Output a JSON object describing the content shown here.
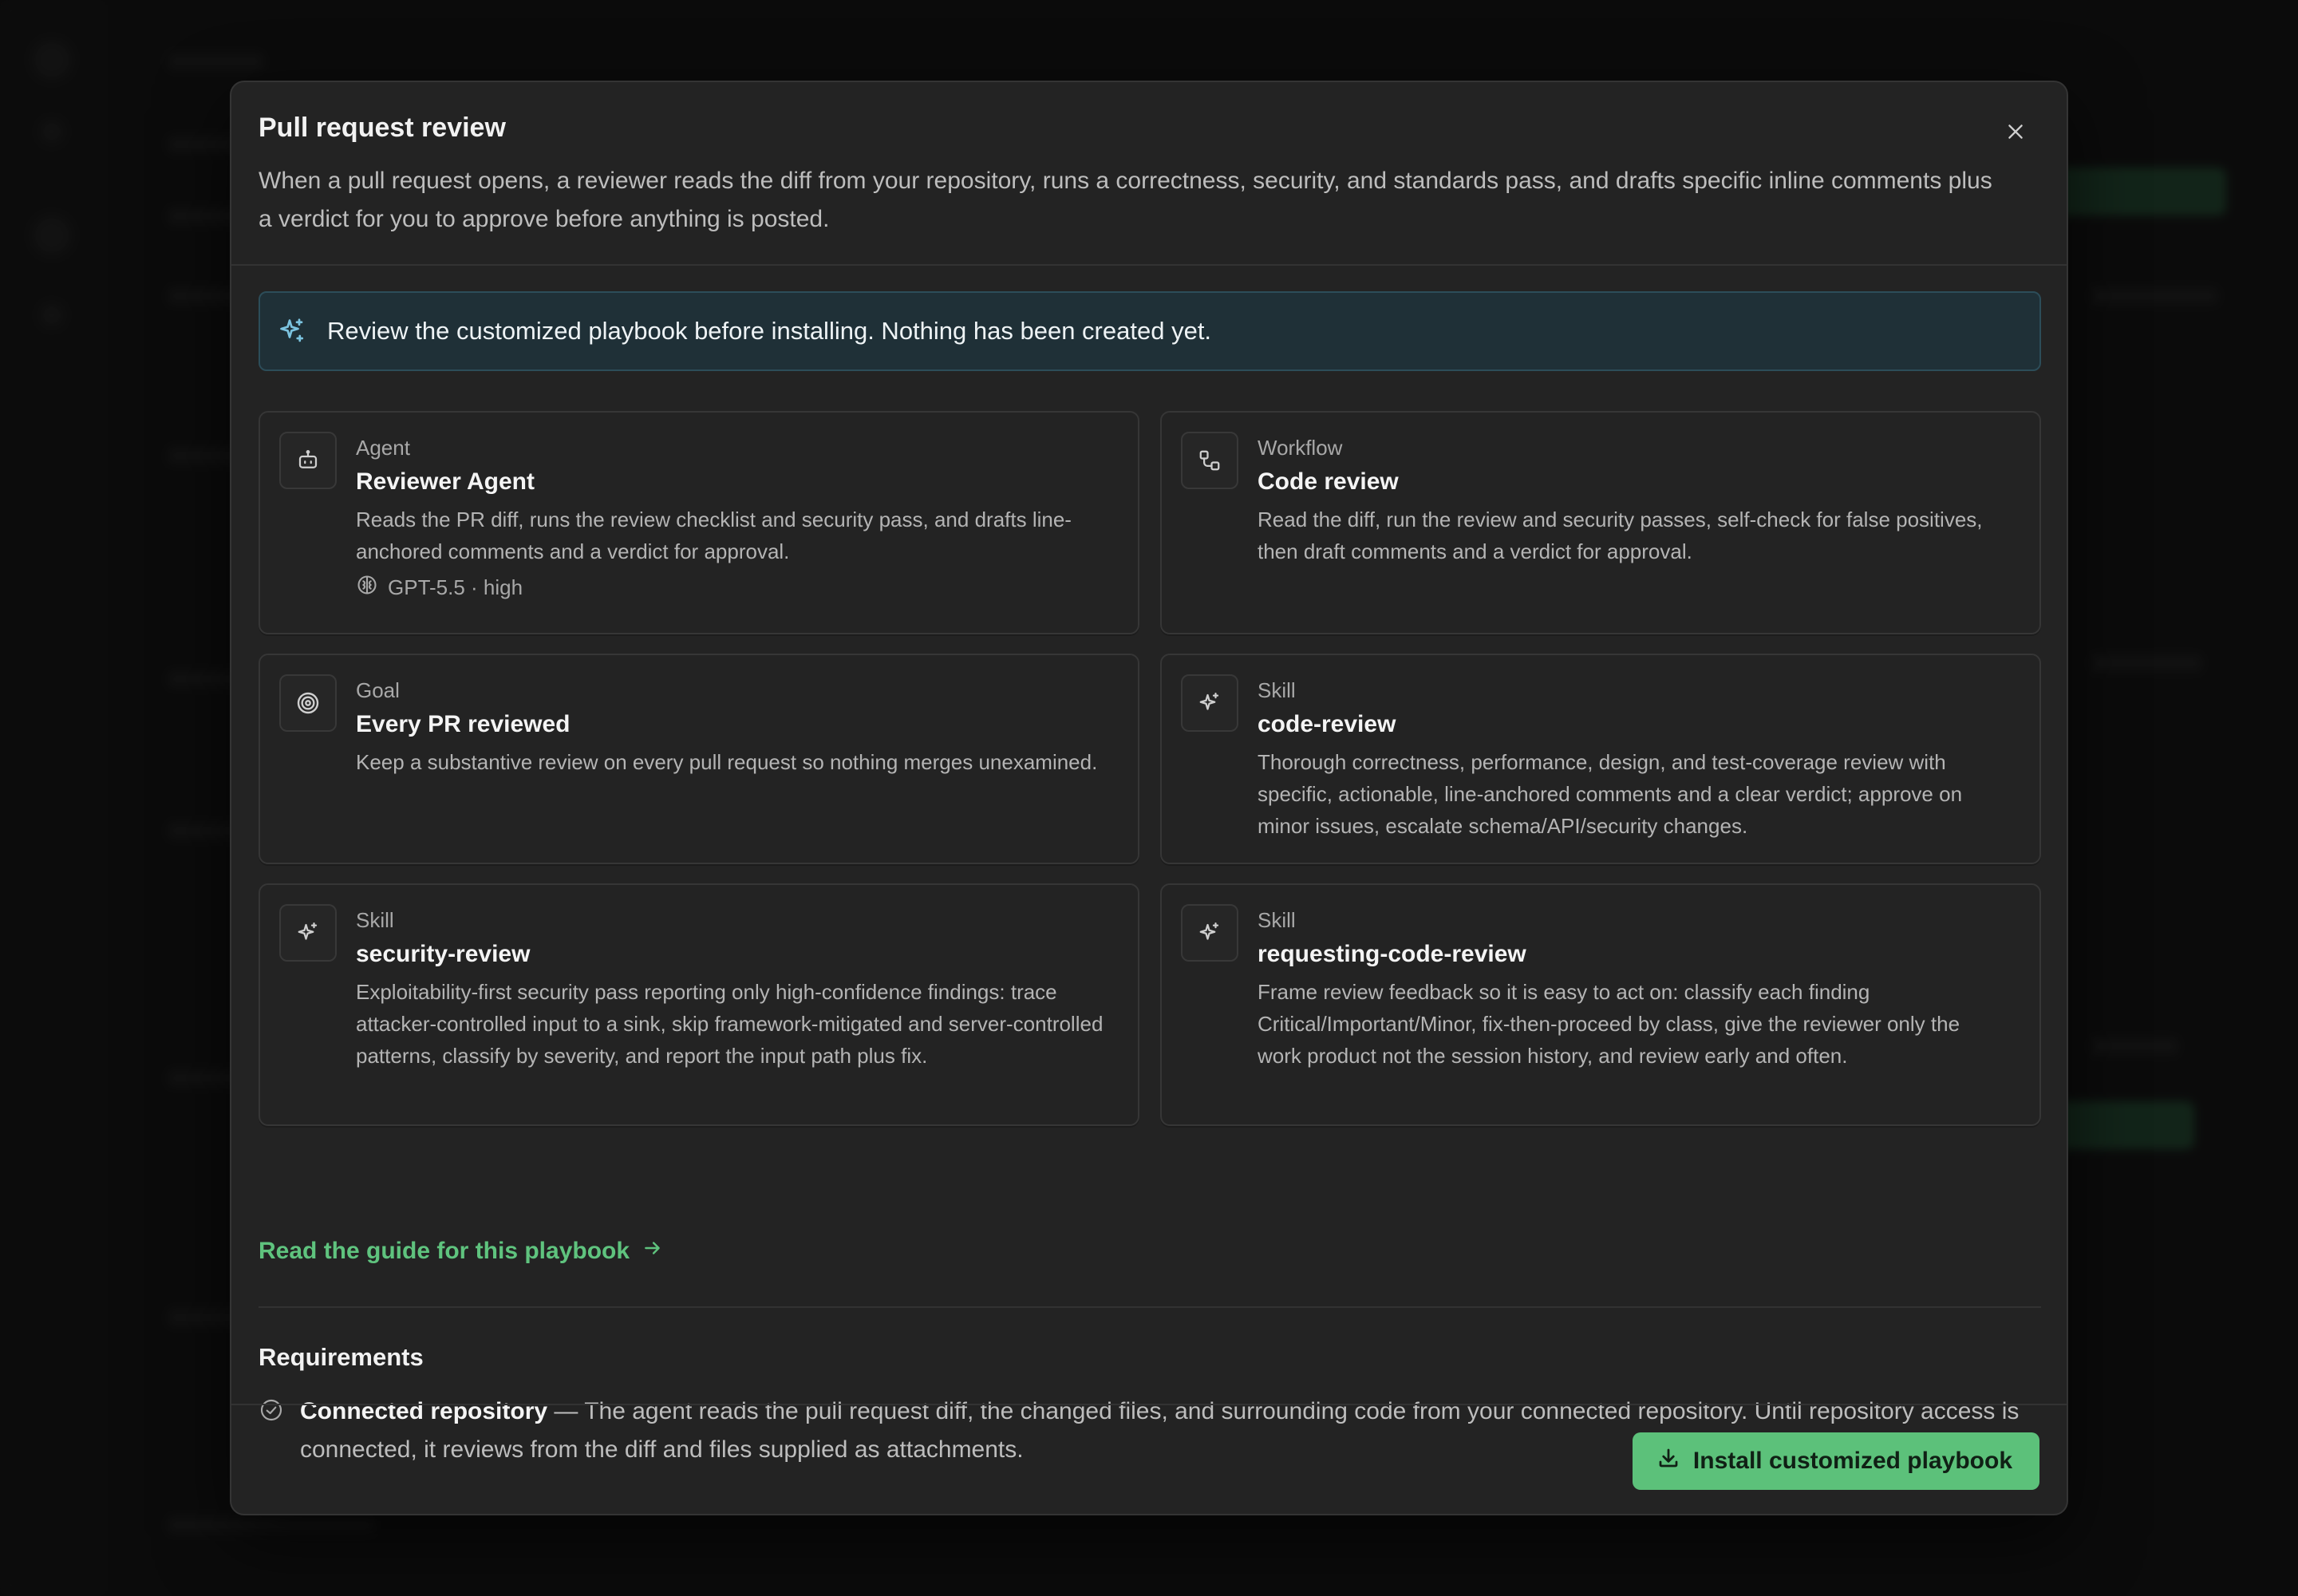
{
  "modal": {
    "title": "Pull request review",
    "description": "When a pull request opens, a reviewer reads the diff from your repository, runs a correctness, security, and standards pass, and drafts specific inline comments plus a verdict for you to approve before anything is posted.",
    "close_icon": "close-icon"
  },
  "notice": {
    "icon": "sparkles-icon",
    "text": "Review the customized playbook before installing. Nothing has been created yet."
  },
  "cards": [
    {
      "icon": "robot-icon",
      "kind": "Agent",
      "name": "Reviewer Agent",
      "description": "Reads the PR diff, runs the review checklist and security pass, and drafts line-anchored comments and a verdict for approval.",
      "meta": "GPT-5.5 · high",
      "meta_icon": "brain-icon"
    },
    {
      "icon": "workflow-icon",
      "kind": "Workflow",
      "name": "Code review",
      "description": "Read the diff, run the review and security passes, self-check for false positives, then draft comments and a verdict for approval."
    },
    {
      "icon": "target-icon",
      "kind": "Goal",
      "name": "Every PR reviewed",
      "description": "Keep a substantive review on every pull request so nothing merges unexamined."
    },
    {
      "icon": "sparkles-icon",
      "kind": "Skill",
      "name": "code-review",
      "description": "Thorough correctness, performance, design, and test-coverage review with specific, actionable, line-anchored comments and a clear verdict; approve on minor issues, escalate schema/API/security changes."
    },
    {
      "icon": "sparkles-icon",
      "kind": "Skill",
      "name": "security-review",
      "description": "Exploitability-first security pass reporting only high-confidence findings: trace attacker-controlled input to a sink, skip framework-mitigated and server-controlled patterns, classify by severity, and report the input path plus fix."
    },
    {
      "icon": "sparkles-icon",
      "kind": "Skill",
      "name": "requesting-code-review",
      "description": "Frame review feedback so it is easy to act on: classify each finding Critical/Important/Minor, fix-then-proceed by class, give the reviewer only the work product not the session history, and review early and often."
    }
  ],
  "guide_link": {
    "label": "Read the guide for this playbook",
    "icon": "arrow-right-icon"
  },
  "requirements": {
    "title": "Requirements",
    "items": [
      {
        "icon": "check-circle-icon",
        "name": "Connected repository",
        "text": " — The agent reads the pull request diff, the changed files, and surrounding code from your connected repository. Until repository access is connected, it reviews from the diff and files supplied as attachments."
      }
    ]
  },
  "footer": {
    "install_label": "Install customized playbook",
    "install_icon": "download-icon"
  },
  "colors": {
    "accent": "#5cc17a",
    "link": "#5fc37e",
    "notice_bg": "#1f3037",
    "notice_border": "#2c4d59",
    "notice_icon": "#7cc4e0"
  }
}
